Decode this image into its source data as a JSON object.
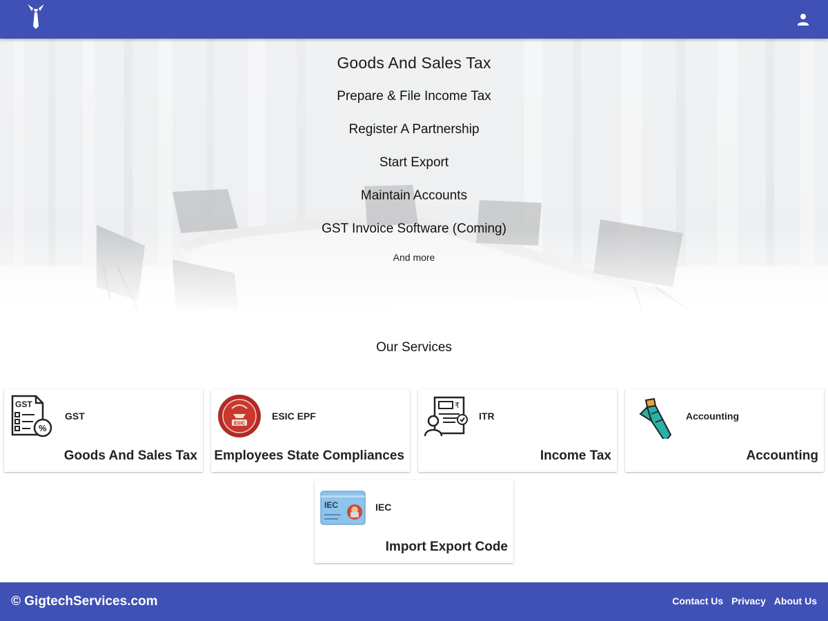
{
  "header": {
    "logo_icon": "tie-logo-icon",
    "account_icon": "person-icon",
    "bar_color": "#3f51b5"
  },
  "hero": {
    "title": "Goods And Sales Tax",
    "items": [
      "Prepare & File Income Tax",
      "Register A Partnership",
      "Start Export",
      "Maintain Accounts",
      "GST Invoice Software (Coming)"
    ],
    "more": "And more"
  },
  "services": {
    "title": "Our Services",
    "cards": [
      {
        "code": "GST",
        "name": "Goods And Sales Tax",
        "icon": "gst-document-icon"
      },
      {
        "code": "ESIC EPF",
        "name": "Employees State Compliances",
        "icon": "esic-seal-icon"
      },
      {
        "code": "ITR",
        "name": "Income Tax",
        "icon": "tax-document-person-icon"
      },
      {
        "code": "Accounting",
        "name": "Accounting",
        "icon": "necktie-icon"
      },
      {
        "code": "IEC",
        "name": "Import Export Code",
        "icon": "iec-card-icon"
      }
    ]
  },
  "footer": {
    "copyright": "© GigtechServices.com",
    "links": [
      "Contact Us",
      "Privacy",
      "About Us"
    ]
  }
}
